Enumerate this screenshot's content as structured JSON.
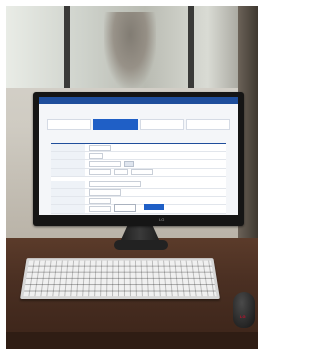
{
  "scene": {
    "description_tag": "photo-of-monitor-keyboard-mouse",
    "monitor_brand": "LG",
    "mouse_brand": "LG"
  },
  "screen_ui": {
    "topbar_links": [
      "",
      ""
    ],
    "page_title": "",
    "util_text": "",
    "steps": [
      "",
      "",
      "",
      ""
    ],
    "active_step_index": 1,
    "section_title": "",
    "rows_group1": [
      "",
      "",
      "",
      ""
    ],
    "rows_group2": [
      "",
      "",
      "",
      ""
    ],
    "buttons": {
      "prev": "",
      "next": ""
    }
  },
  "colors": {
    "brand_blue": "#1f5fc6",
    "topbar": "#1f4e9c",
    "lg_red": "#c8102e"
  }
}
